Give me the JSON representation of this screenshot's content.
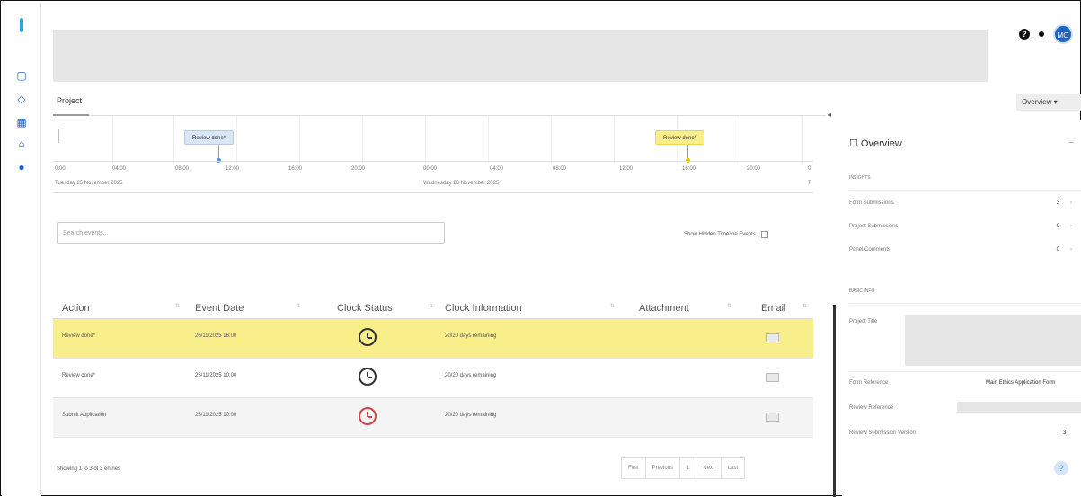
{
  "rail": {
    "icons": [
      "document-icon",
      "shield-icon",
      "grid-icon",
      "home-icon",
      "settings-icon"
    ]
  },
  "topbar": {
    "help_glyph": "?",
    "avatar_initials": "MO"
  },
  "tabs": {
    "project_label": "Project"
  },
  "timeline": {
    "ticks": [
      "0:00",
      "04:00",
      "08:00",
      "12:00",
      "16:00",
      "20:00",
      "00:00",
      "04:00",
      "08:00",
      "12:00",
      "16:00",
      "20:00",
      "0"
    ],
    "day_1": "Tuesday 25 November 2025",
    "day_2": "Wednesday 26 November 2025",
    "day_2_trailing": "T",
    "event_1": "Review done*",
    "event_2": "Review done*"
  },
  "controls": {
    "show_hidden_label": "Show Hidden Timeline Events",
    "search_placeholder": "Search events..."
  },
  "table": {
    "headers": [
      "Action",
      "Event Date",
      "Clock Status",
      "Clock Information",
      "Attachment",
      "Email"
    ],
    "rows": [
      {
        "action": "Review done*",
        "date": "26/11/2025 16:00",
        "info": "20/20 days remaining",
        "clock_color": "dark"
      },
      {
        "action": "Review done*",
        "date": "25/11/2025 10:00",
        "info": "20/20 days remaining",
        "clock_color": "dark"
      },
      {
        "action": "Submit Application",
        "date": "25/11/2025 10:00",
        "info": "20/20 days remaining",
        "clock_color": "red"
      }
    ],
    "footer_info": "Showing 1 to 3 of 3 entries",
    "pager": [
      "First",
      "Previous",
      "1",
      "Next",
      "Last"
    ]
  },
  "panel": {
    "tab_label": "Overview",
    "title": "Overview",
    "section_insights": "INSIGHTS",
    "insights": [
      {
        "label": "Form Submissions",
        "count": "3"
      },
      {
        "label": "Project Submissions",
        "count": "0"
      },
      {
        "label": "Panel Comments",
        "count": "0"
      }
    ],
    "section_basic": "BASIC INFO",
    "project_title_label": "Project Title",
    "form_reference_label": "Form Reference",
    "form_reference_value": "Main Ethics Application Form",
    "review_reference_label": "Review Reference",
    "review_submission_version_label": "Review Submission Version",
    "review_submission_version_value": "3"
  }
}
